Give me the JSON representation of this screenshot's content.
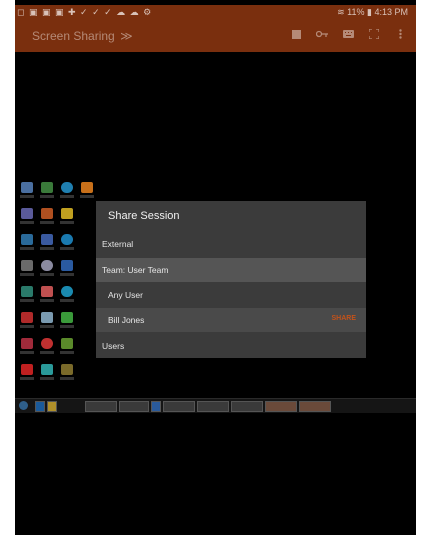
{
  "status_bar": {
    "left_icons": [
      "notification-icon",
      "gallery-icon",
      "lock-icon",
      "mail-icon",
      "plus-icon",
      "check-icon",
      "check-icon",
      "check-icon",
      "cloud-icon",
      "cloud-icon",
      "gear-icon"
    ],
    "battery": "11%",
    "time": "4:13 PM"
  },
  "app_bar": {
    "title": "Screen Sharing",
    "title_chevron": "≫",
    "actions": [
      "stop-icon",
      "key-icon",
      "keyboard-icon",
      "fullscreen-icon",
      "more-vert-icon"
    ],
    "color": "#7a2f0e"
  },
  "dialog": {
    "title": "Share Session",
    "rows": [
      {
        "label": "External"
      },
      {
        "label": "Team: User Team"
      },
      {
        "label": "Any User"
      },
      {
        "label": "Bill Jones",
        "action": "SHARE"
      },
      {
        "label": "Users"
      }
    ],
    "accent": "#c2521a"
  }
}
